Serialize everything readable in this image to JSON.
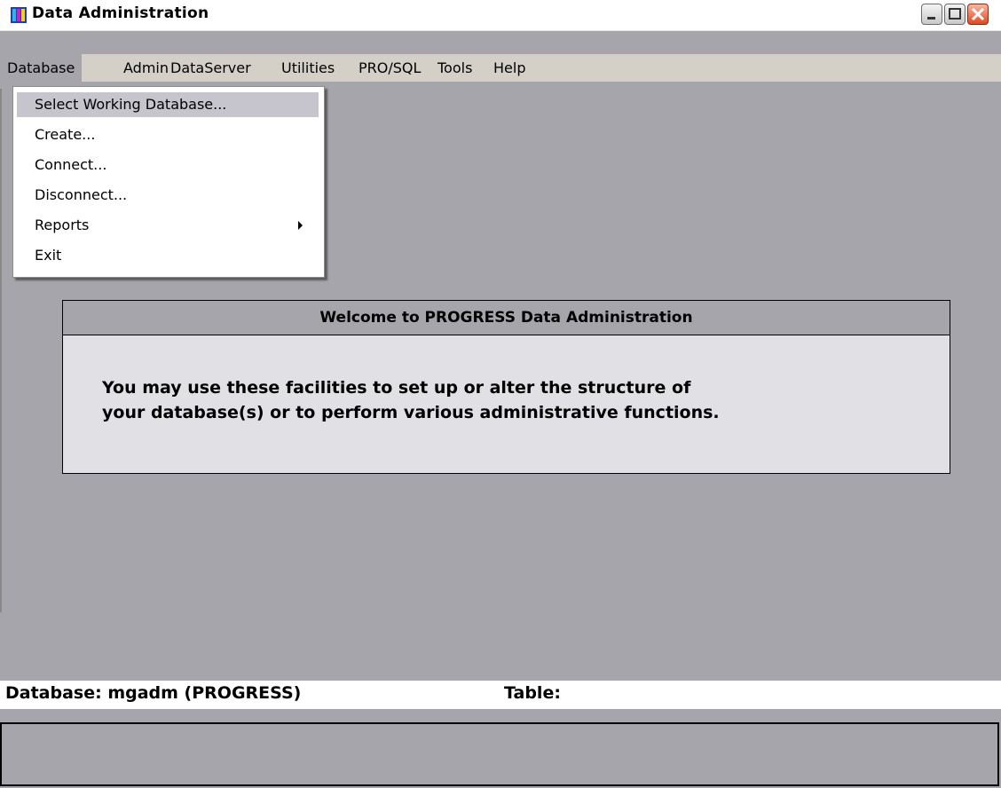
{
  "window": {
    "title": "Data Administration"
  },
  "menubar": {
    "items": [
      "Database",
      "Admin",
      "DataServer",
      "Utilities",
      "PRO/SQL",
      "Tools",
      "Help"
    ]
  },
  "dropdown": {
    "items": [
      {
        "label": "Select Working Database...",
        "selected": true,
        "submenu": false
      },
      {
        "label": "Create...",
        "selected": false,
        "submenu": false
      },
      {
        "label": "Connect...",
        "selected": false,
        "submenu": false
      },
      {
        "label": "Disconnect...",
        "selected": false,
        "submenu": false
      },
      {
        "label": "Reports",
        "selected": false,
        "submenu": true
      },
      {
        "label": "Exit",
        "selected": false,
        "submenu": false
      }
    ]
  },
  "welcome": {
    "heading": "Welcome to  PROGRESS Data Administration",
    "line1": "You may use these facilities to set up or alter the structure of",
    "line2": "your database(s) or to perform various administrative functions."
  },
  "status": {
    "database": "Database: mgadm (PROGRESS)",
    "table": "Table:"
  },
  "colors": {
    "background": "#a6a5ac",
    "menubar": "#d4d0c8",
    "panel": "#e1e0e5",
    "selected_item": "#c6c4cc"
  }
}
